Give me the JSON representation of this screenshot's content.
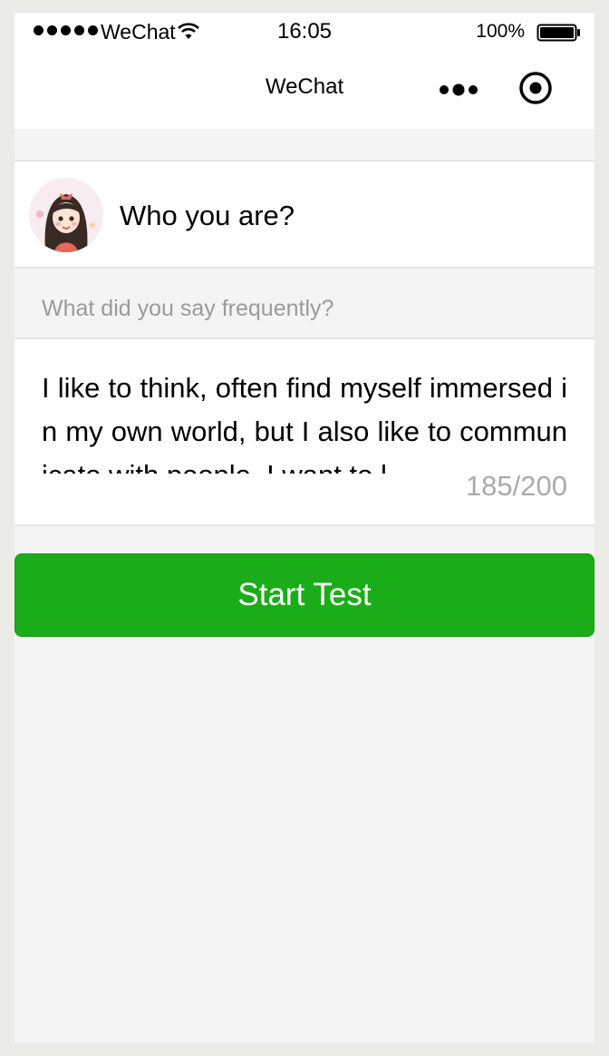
{
  "status_bar": {
    "carrier": "WeChat",
    "time": "16:05",
    "battery": "100%"
  },
  "nav": {
    "title": "WeChat",
    "icons": [
      "more-icon",
      "record-icon"
    ]
  },
  "profile": {
    "name": "Who you are?"
  },
  "prompt": {
    "label": "What did you say frequently?",
    "text": "I like to think, often find myself immersed in my own world, but I also like to communicate with people. I want to l",
    "counter": "185/200"
  },
  "actions": {
    "start_label": "Start Test"
  },
  "colors": {
    "accent": "#1aad19",
    "background": "#f4f4f4",
    "muted_text": "#9b9b9b"
  }
}
